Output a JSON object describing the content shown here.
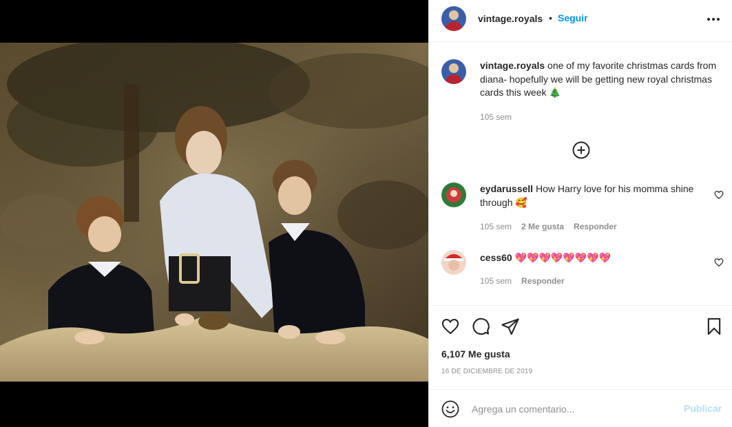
{
  "post": {
    "username": "vintage.royals",
    "separator": "•",
    "follow_label": "Seguir",
    "more_icon": "more-options-icon"
  },
  "caption": {
    "username": "vintage.royals",
    "text": "one of my favorite christmas cards from diana- hopefully we will be getting new royal christmas cards this week 🎄",
    "time": "105 sem"
  },
  "load_more_icon": "plus-circle-icon",
  "comments": [
    {
      "username": "eydarussell",
      "text": "How Harry love for his momma shine through 🥰",
      "time": "105 sem",
      "likes": "2 Me gusta",
      "reply_label": "Responder"
    },
    {
      "username": "cess60",
      "text": "💖💖💖💖💖💖💖💖",
      "time": "105 sem",
      "reply_label": "Responder"
    }
  ],
  "actions": {
    "like_icon": "heart-icon",
    "comment_icon": "comment-icon",
    "share_icon": "share-icon",
    "save_icon": "bookmark-icon"
  },
  "likes_text": "6,107 Me gusta",
  "date": "16 de diciembre de 2019",
  "add_comment": {
    "placeholder": "Agrega un comentario...",
    "publish_label": "Publicar",
    "emoji_icon": "emoji-icon"
  },
  "colors": {
    "accent": "#0095f6",
    "publish_disabled": "#b2dffc",
    "secondary_text": "#8e8e8e",
    "border": "#efefef"
  }
}
